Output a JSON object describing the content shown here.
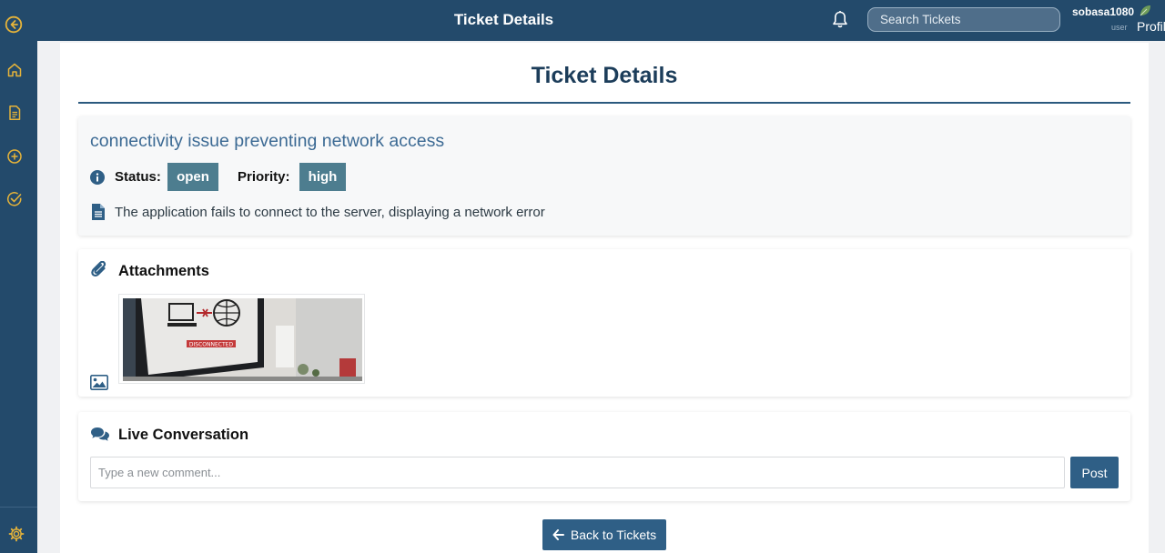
{
  "colors": {
    "nav_bg": "#234a6b",
    "accent_icon": "#e5b33a",
    "badge_bg": "#4d7d8f",
    "button_bg": "#2f5f86",
    "ticket_title": "#3c6a94",
    "page_title": "#1c3d5a"
  },
  "sidebar": {
    "items": [
      {
        "icon": "arrow-left-circle-icon"
      },
      {
        "icon": "home-icon"
      },
      {
        "icon": "document-icon"
      },
      {
        "icon": "plus-circle-icon"
      },
      {
        "icon": "check-circle-icon"
      }
    ],
    "bottom_icon": "gear-icon"
  },
  "header": {
    "title": "Ticket Details",
    "search_placeholder": "Search Tickets",
    "user_name": "sobasa1080",
    "user_role": "user",
    "profile_alt": "Profile"
  },
  "main": {
    "page_title": "Ticket Details",
    "ticket": {
      "title": "connectivity issue preventing network access",
      "status_label": "Status:",
      "status_value": "open",
      "priority_label": "Priority:",
      "priority_value": "high",
      "description": "The application fails to connect to the server, displaying a network error"
    },
    "attachments": {
      "title": "Attachments",
      "image_text": "DISCONNECTED"
    },
    "conversation": {
      "title": "Live Conversation",
      "comment_placeholder": "Type a new comment...",
      "post_label": "Post"
    },
    "back_label": "Back to Tickets"
  }
}
